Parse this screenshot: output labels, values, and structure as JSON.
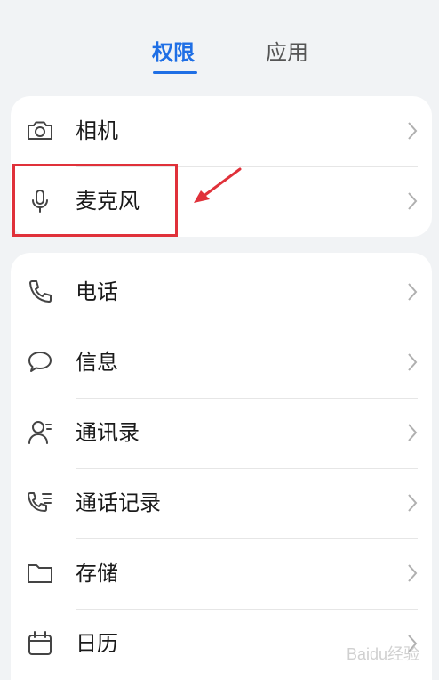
{
  "tabs": {
    "permissions": "权限",
    "apps": "应用"
  },
  "group1": [
    {
      "icon": "camera-icon",
      "label": "相机"
    },
    {
      "icon": "microphone-icon",
      "label": "麦克风"
    }
  ],
  "group2": [
    {
      "icon": "phone-icon",
      "label": "电话"
    },
    {
      "icon": "message-icon",
      "label": "信息"
    },
    {
      "icon": "contacts-icon",
      "label": "通讯录"
    },
    {
      "icon": "call-log-icon",
      "label": "通话记录"
    },
    {
      "icon": "folder-icon",
      "label": "存储"
    },
    {
      "icon": "calendar-icon",
      "label": "日历"
    }
  ],
  "watermark": "Baidu经验",
  "colors": {
    "accent": "#1f6fe5",
    "annotation": "#e0313a",
    "background": "#f1f3f5"
  }
}
